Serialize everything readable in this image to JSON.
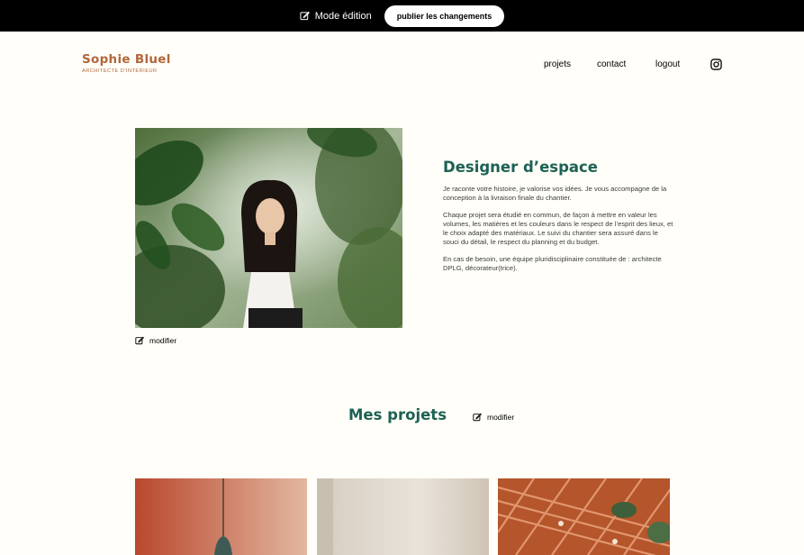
{
  "edit_bar": {
    "mode_label": "Mode édition",
    "publish_label": "publier les changements"
  },
  "header": {
    "logo_title": "Sophie Bluel",
    "logo_subtitle": "ARCHITECTE D'INTÉRIEUR",
    "nav": {
      "projets": "projets",
      "contact": "contact",
      "logout": "logout"
    },
    "instagram_icon": "instagram-icon"
  },
  "introduction": {
    "title": "Designer d’espace",
    "paragraphs": [
      "Je raconte votre histoire, je valorise vos idées. Je vous accompagne de la conception à la livraison finale du chantier.",
      "Chaque projet sera étudié en commun, de façon à mettre en valeur les volumes, les matières et les couleurs dans le respect de l’esprit des lieux, et le choix adapté des matériaux. Le suivi du chantier sera assuré dans le souci du détail, le respect du planning et du budget.",
      "En cas de besoin, une équipe pluridisciplinaire constituée de : architecte DPLG, décorateur(trice)."
    ],
    "modifier_label": "modifier"
  },
  "portfolio": {
    "title": "Mes projets",
    "modifier_label": "modifier"
  },
  "colors": {
    "brand": "#B1663C",
    "accent_green": "#1D6154",
    "background": "#FFFEF8",
    "edit_bar": "#000000"
  }
}
